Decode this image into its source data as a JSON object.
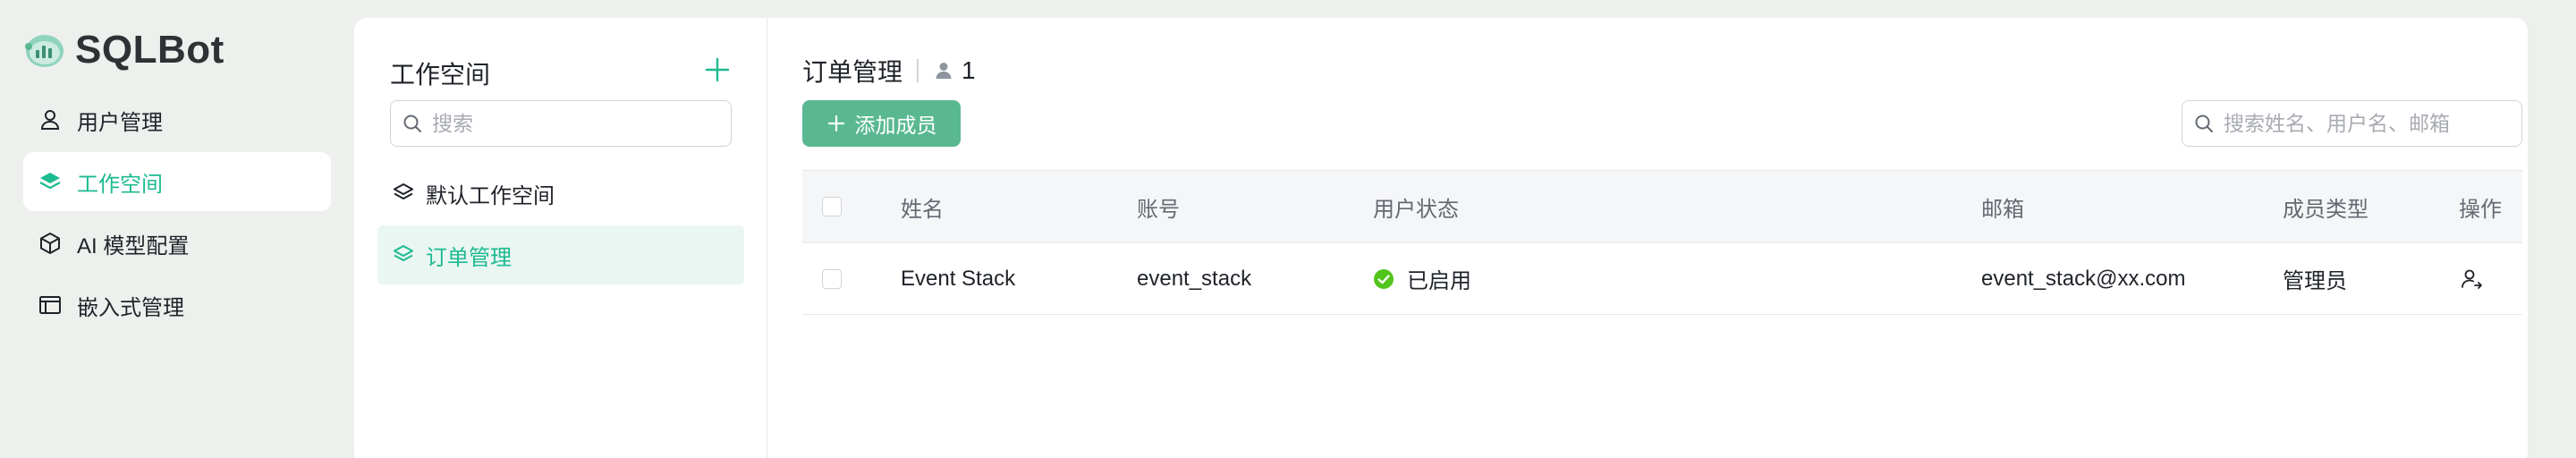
{
  "app": {
    "brand_name": "SQLBot",
    "accent_color": "#1cba90",
    "primary_button_color": "#5ab891"
  },
  "nav": {
    "items": [
      {
        "label": "用户管理",
        "icon": "user-icon",
        "active": false
      },
      {
        "label": "工作空间",
        "icon": "layers-icon",
        "active": true
      },
      {
        "label": "AI 模型配置",
        "icon": "cube-icon",
        "active": false
      },
      {
        "label": "嵌入式管理",
        "icon": "embed-window-icon",
        "active": false
      }
    ]
  },
  "workspace_panel": {
    "title": "工作空间",
    "add_icon": "plus-icon",
    "search_placeholder": "搜索",
    "items": [
      {
        "label": "默认工作空间",
        "icon": "layers-icon",
        "active": false
      },
      {
        "label": "订单管理",
        "icon": "layers-icon",
        "active": true
      }
    ]
  },
  "members": {
    "title": "订单管理",
    "member_count": "1",
    "add_button_label": "添加成员",
    "search_placeholder": "搜索姓名、用户名、邮箱",
    "columns": {
      "name": "姓名",
      "account": "账号",
      "status": "用户状态",
      "email": "邮箱",
      "member_type": "成员类型",
      "actions": "操作"
    },
    "rows": [
      {
        "name": "Event Stack",
        "account": "event_stack",
        "status": "已启用",
        "status_color": "#52c41a",
        "email": "event_stack@xx.com",
        "member_type": "管理员",
        "action_icon": "user-transfer-icon"
      }
    ]
  }
}
